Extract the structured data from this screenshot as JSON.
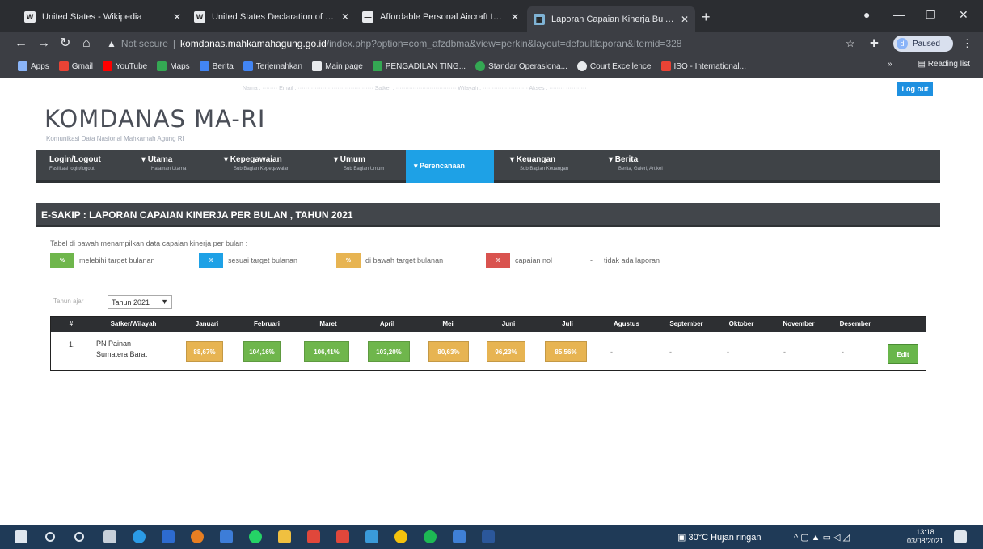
{
  "browser": {
    "tabs": [
      {
        "title": "United States - Wikipedia",
        "fav": "W",
        "favcolor": "#e8eaed"
      },
      {
        "title": "United States Declaration of Ind...",
        "fav": "W",
        "favcolor": "#e8eaed"
      },
      {
        "title": "Affordable Personal Aircraft to ...",
        "fav": "—",
        "favcolor": "#e8eaed"
      },
      {
        "title": "Laporan Capaian Kinerja Bulanan",
        "fav": "▦",
        "favcolor": "#7fb3d5"
      }
    ],
    "new_tab": "+",
    "url_warning": "Not secure",
    "url_host": "komdanas.mahkamahagung.go.id",
    "url_path": "/index.php?option=com_afzdbma&view=perkin&layout=defaultlaporan&Itemid=328",
    "profile_initial": "d",
    "profile_status": "Paused",
    "bookmarks": [
      {
        "label": "Apps",
        "color": "#8ab4f8"
      },
      {
        "label": "Gmail",
        "color": "#ea4335"
      },
      {
        "label": "YouTube",
        "color": "#ff0000"
      },
      {
        "label": "Maps",
        "color": "#34a853"
      },
      {
        "label": "Berita",
        "color": "#4285f4"
      },
      {
        "label": "Terjemahkan",
        "color": "#4285f4"
      },
      {
        "label": "Main page",
        "color": "#e8eaed"
      },
      {
        "label": "PENGADILAN TING...",
        "color": "#34a853"
      },
      {
        "label": "Standar Operasiona...",
        "color": "#34a853"
      },
      {
        "label": "Court Excellence",
        "color": "#e8eaed"
      },
      {
        "label": "ISO - International...",
        "color": "#ea4335"
      }
    ],
    "reading_list": "Reading list",
    "more": "»"
  },
  "page": {
    "user_line": "Nama : ········   Email : ········································   Satker : ································   Wilayah : ························   Akses : ········   ···········",
    "logout": "Log out",
    "logo": "KOMDANAS MA-RI",
    "logo_sub": "Komunikasi Data Nasional Mahkamah Agung RI",
    "menu": [
      {
        "label": "Login/Logout",
        "sub": "Fasilitasi login/logout",
        "active": false
      },
      {
        "label": "▾ Utama",
        "sub": "Halaman Utama",
        "active": false
      },
      {
        "label": "▾ Kepegawaian",
        "sub": "Sub Bagian Kepegawaian",
        "active": false
      },
      {
        "label": "▾ Umum",
        "sub": "Sub Bagian Umum",
        "active": false
      },
      {
        "label": "▾ Perencanaan",
        "sub": "",
        "active": true
      },
      {
        "label": "▾ Keuangan",
        "sub": "Sub Bagian Keuangan",
        "active": false
      },
      {
        "label": "▾ Berita",
        "sub": "Berita, Galeri, Artikel",
        "active": false
      }
    ],
    "section_title": "E-SAKIP : LAPORAN CAPAIAN KINERJA PER BULAN , TAHUN 2021",
    "description": "Tabel di bawah menampilkan data capaian kinerja per bulan :",
    "legend": [
      {
        "symbol": "%",
        "label": "melebihi target bulanan",
        "color": "#6fb64c"
      },
      {
        "symbol": "%",
        "label": "sesuai target bulanan",
        "color": "#1ea1e6"
      },
      {
        "symbol": "%",
        "label": "di bawah target bulanan",
        "color": "#e7b452"
      },
      {
        "symbol": "%",
        "label": "capaian nol",
        "color": "#d9534f"
      },
      {
        "symbol": "-",
        "label": "tidak ada laporan",
        "color": ""
      }
    ],
    "year_label": "Tahun ajar",
    "year_value": "Tahun 2021",
    "table": {
      "headers": [
        "#",
        "Satker/Wilayah",
        "Januari",
        "Februari",
        "Maret",
        "April",
        "Mei",
        "Juni",
        "Juli",
        "Agustus",
        "September",
        "Oktober",
        "November",
        "Desember"
      ],
      "rows": [
        {
          "no": "1.",
          "satker_line1": "PN Painan",
          "satker_line2": "Sumatera Barat",
          "values": [
            {
              "text": "88,67%",
              "status": "yellow"
            },
            {
              "text": "104,16%",
              "status": "green"
            },
            {
              "text": "106,41%",
              "status": "green"
            },
            {
              "text": "103,20%",
              "status": "green"
            },
            {
              "text": "80,63%",
              "status": "yellow"
            },
            {
              "text": "96,23%",
              "status": "yellow"
            },
            {
              "text": "85,56%",
              "status": "yellow"
            },
            {
              "text": "-",
              "status": "none"
            },
            {
              "text": "-",
              "status": "none"
            },
            {
              "text": "-",
              "status": "none"
            },
            {
              "text": "-",
              "status": "none"
            },
            {
              "text": "-",
              "status": "none"
            }
          ],
          "action": "Edit"
        }
      ]
    }
  },
  "taskbar": {
    "weather": "30°C  Hujan ringan",
    "time": "13:18",
    "date": "03/08/2021"
  }
}
